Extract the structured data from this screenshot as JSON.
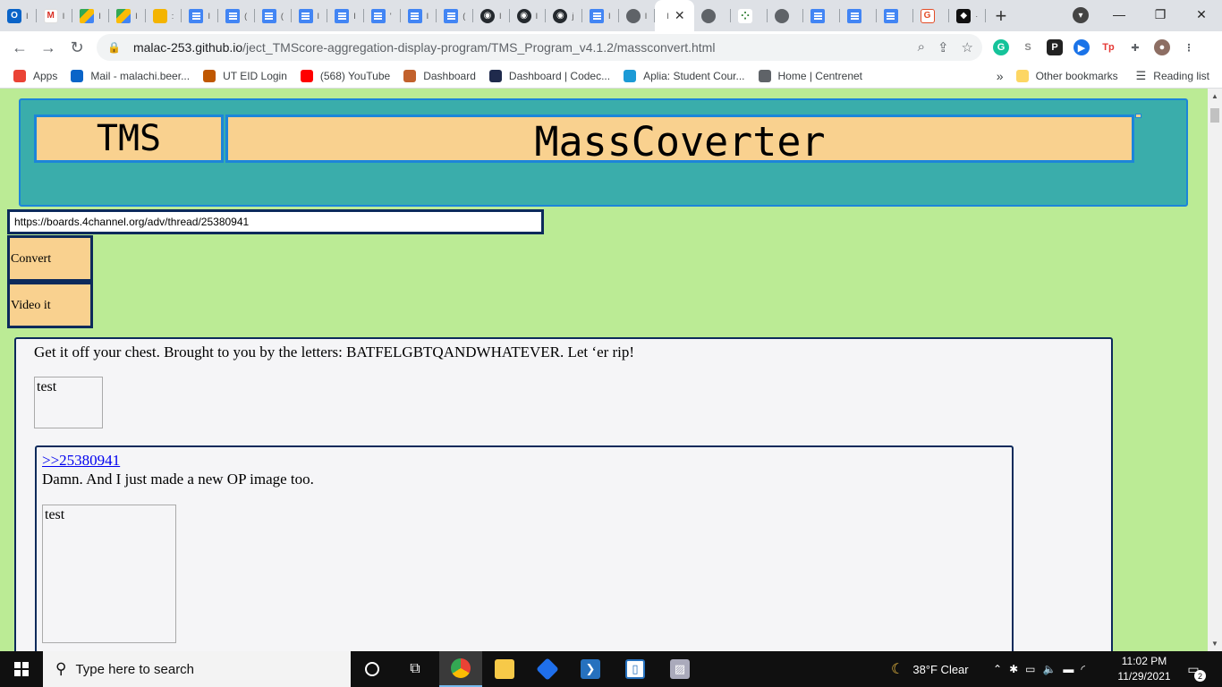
{
  "browser": {
    "tabs": [
      {
        "icon": "outlook-icon",
        "char": "I"
      },
      {
        "icon": "gmail-icon",
        "char": "I"
      },
      {
        "icon": "drive-icon",
        "char": "I"
      },
      {
        "icon": "drive-icon",
        "char": "I"
      },
      {
        "icon": "slides-icon",
        "char": ":"
      },
      {
        "icon": "docs-icon",
        "char": "I"
      },
      {
        "icon": "docs-icon",
        "char": "("
      },
      {
        "icon": "docs-icon",
        "char": "("
      },
      {
        "icon": "docs-icon",
        "char": "I"
      },
      {
        "icon": "docs-icon",
        "char": "I"
      },
      {
        "icon": "docs-icon",
        "char": "'"
      },
      {
        "icon": "docs-icon",
        "char": "I"
      },
      {
        "icon": "docs-icon",
        "char": "("
      },
      {
        "icon": "github-icon",
        "char": "I"
      },
      {
        "icon": "github-icon",
        "char": "I"
      },
      {
        "icon": "github-icon",
        "char": "j"
      },
      {
        "icon": "docs-icon",
        "char": "I"
      },
      {
        "icon": "globe-icon",
        "char": "I"
      }
    ],
    "active_tab": {
      "char": "I",
      "close": "✕"
    },
    "tabs_after": [
      {
        "icon": "globe-icon",
        "char": ""
      },
      {
        "icon": "dots-icon",
        "char": ""
      },
      {
        "icon": "globe-icon",
        "char": ""
      },
      {
        "icon": "docs-icon",
        "char": ""
      },
      {
        "icon": "docs-icon",
        "char": ""
      },
      {
        "icon": "docs-icon",
        "char": ""
      },
      {
        "icon": "grammarly-icon",
        "char": ""
      },
      {
        "icon": "black-icon",
        "char": "·"
      }
    ],
    "new_tab": "+",
    "url_host": "malac-253.github.io",
    "url_path": "/ject_TMScore-aggregation-display-program/TMS_Program_v4.1.2/massconvert.html",
    "bookmarks": [
      {
        "label": "Apps",
        "icon": "apps-icon",
        "color": "#ea4335"
      },
      {
        "label": "Mail - malachi.beer...",
        "icon": "outlook-icon",
        "color": "#0a64c8"
      },
      {
        "label": "UT EID Login",
        "icon": "ut-icon",
        "color": "#bf5700"
      },
      {
        "label": "(568) YouTube",
        "icon": "youtube-icon",
        "color": "#ff0000"
      },
      {
        "label": "Dashboard",
        "icon": "dashboard-icon",
        "color": "#c2612c"
      },
      {
        "label": "Dashboard | Codec...",
        "icon": "codecademy-icon",
        "color": "#1f2a4c"
      },
      {
        "label": "Aplia: Student Cour...",
        "icon": "aplia-icon",
        "color": "#1c9ad6"
      },
      {
        "label": "Home | Centrenet",
        "icon": "globe-icon",
        "color": "#5f6368"
      }
    ],
    "bookmarks_more": "»",
    "other_bookmarks": "Other bookmarks",
    "reading_list": "Reading list"
  },
  "page": {
    "header_left": "TMS",
    "header_title": "MassCoverter",
    "url_input_value": "https://boards.4channel.org/adv/thread/25380941",
    "convert_label": "Convert",
    "video_label": "Video it",
    "op_text": "Get it off your chest. Brought to you by the letters: BATFELGBTQANDWHATEVER. Let ‘er rip!",
    "op_img_alt": "test",
    "reply_link": ">>25380941",
    "reply_text": "Damn. And I just made a new OP image too.",
    "reply_img_alt": "test"
  },
  "taskbar": {
    "search_placeholder": "Type here to search",
    "weather": "38°F  Clear",
    "time": "11:02 PM",
    "date": "11/29/2021",
    "notifications": "2"
  },
  "colors": {
    "page_bg": "#bbeb95",
    "header_bg": "#3aadab",
    "header_border": "#1c85d9",
    "box_fill": "#f9d18f",
    "dark_border": "#0c2a5b"
  }
}
